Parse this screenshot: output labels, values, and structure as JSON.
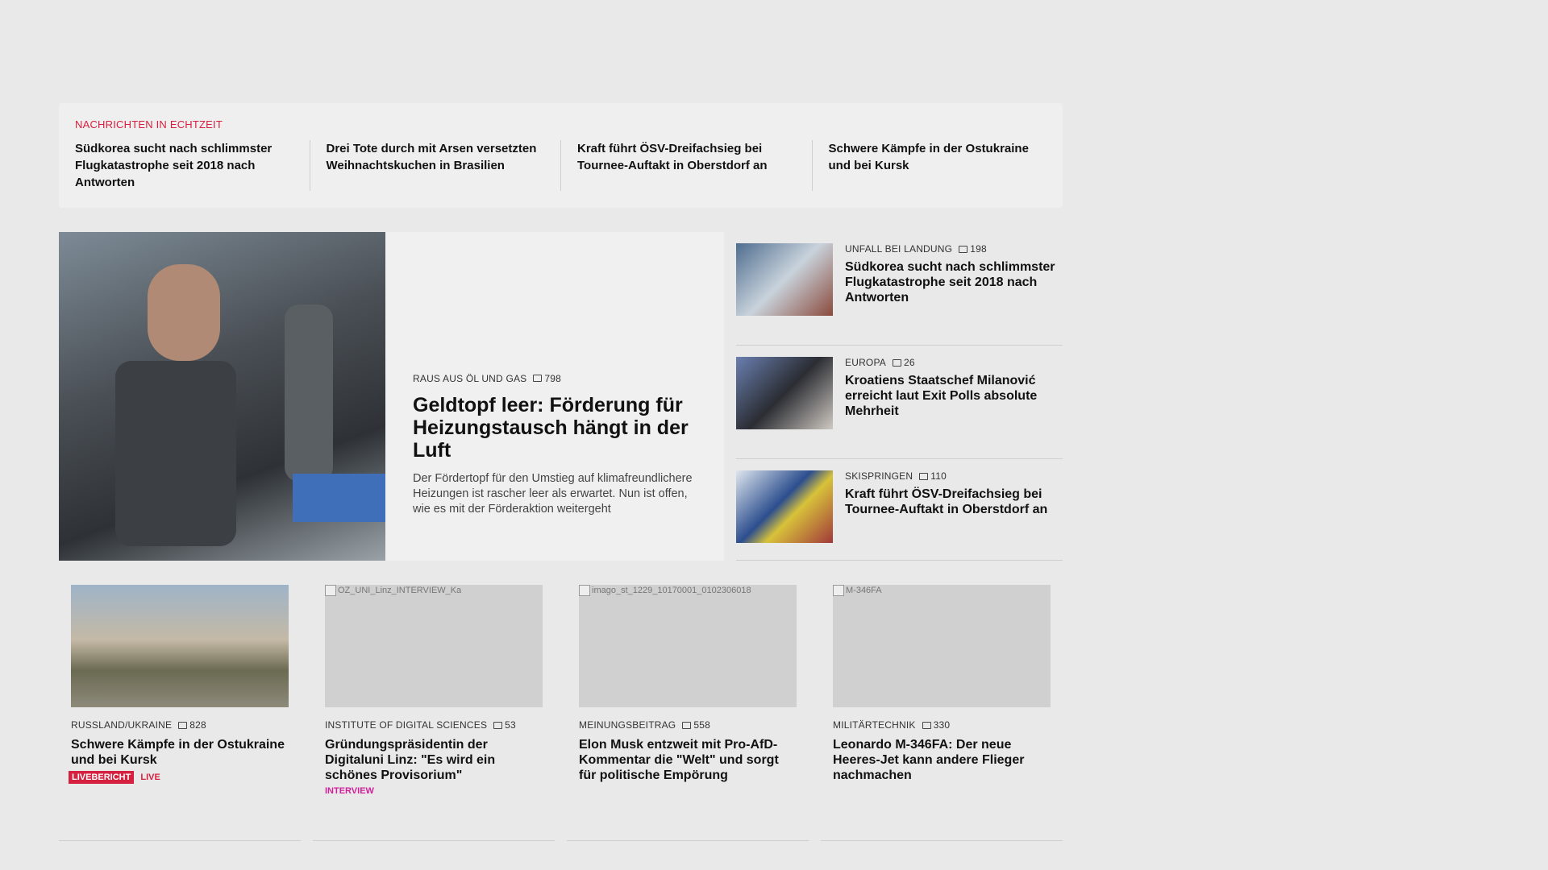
{
  "ticker": {
    "label": "NACHRICHTEN IN ECHTZEIT",
    "items": [
      "Südkorea sucht nach schlimmster Flugkatastrophe seit 2018 nach Antworten",
      "Drei Tote durch mit Arsen versetzten Weihnachtskuchen in Brasilien",
      "Kraft führt ÖSV-Dreifachsieg bei Tournee-Auftakt in Oberstdorf an",
      "Schwere Kämpfe in der Ostukraine und bei Kursk"
    ]
  },
  "hero": {
    "kicker": "RAUS AUS ÖL UND GAS",
    "comments": "798",
    "title": "Geldtopf leer: Förderung für Heizungstausch hängt in der Luft",
    "teaser": "Der Fördertopf für den Umstieg auf klimafreundli­chere Heizungen ist rascher leer als erwartet. Nun ist offen, wie es mit der Förderaktion weitergeht"
  },
  "side": [
    {
      "kicker": "UNFALL BEI LANDUNG",
      "comments": "198",
      "title": "Südkorea sucht nach schlimmster Flugkatastrophe seit 2018 nach Antworten"
    },
    {
      "kicker": "EUROPA",
      "comments": "26",
      "title": "Kroatiens Staatschef Milanović erreicht laut Exit Polls absolute Mehrheit"
    },
    {
      "kicker": "SKISPRINGEN",
      "comments": "110",
      "title": "Kraft führt ÖSV-Dreifachsieg bei Tournee-Auftakt in Oberstdorf an"
    }
  ],
  "cards": [
    {
      "alt": "",
      "kicker": "RUSSLAND/UKRAINE",
      "comments": "828",
      "title": "Schwere Kämpfe in der Ostukraine und bei Kursk",
      "badge": "LIVEBERICHT",
      "tag": "LIVE"
    },
    {
      "alt": "OZ_UNI_Linz_INTERVIEW_Ka",
      "kicker": "INSTITUTE OF DIGITAL SCIENCES",
      "comments": "53",
      "title": "Gründungspräsidentin der Digitaluni Linz: \"Es wird ein schönes Provisorium\"",
      "tag": "INTERVIEW"
    },
    {
      "alt": "imago_st_1229_10170001_0102306018",
      "kicker": "MEINUNGSBEITRAG",
      "comments": "558",
      "title": "Elon Musk entzweit mit Pro-AfD-Kommentar die \"Welt\" und sorgt für politische Empörung"
    },
    {
      "alt": "M-346FA",
      "kicker": "MILITÄRTECHNIK",
      "comments": "330",
      "title": "Leonardo M-346FA: Der neue Heeres-Jet kann andere Flieger nachmachen"
    }
  ]
}
